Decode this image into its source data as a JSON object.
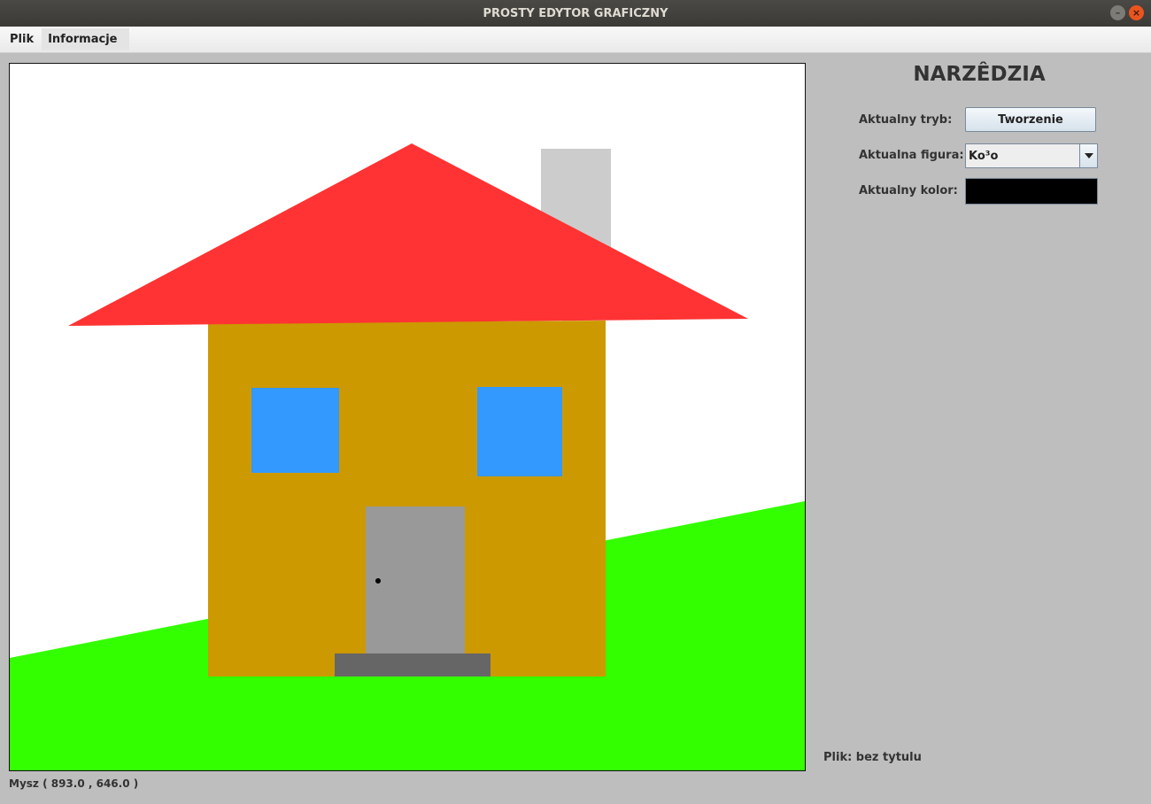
{
  "window": {
    "title": "PROSTY EDYTOR GRAFICZNY",
    "minimize_glyph": "–",
    "close_glyph": "×"
  },
  "menu": {
    "file_label": "Plik",
    "info_label": "Informacje"
  },
  "canvas": {
    "background": "#ffffff",
    "colors": {
      "grass": "#33ff00",
      "roof": "#ff3333",
      "chimney": "#cccccc",
      "wall": "#cc9900",
      "window": "#3399ff",
      "door": "#999999",
      "step": "#666666",
      "door_knob": "#000000"
    }
  },
  "status": {
    "mouse": "Mysz ( 893.0 , 646.0 )",
    "file": "Plik: bez tytulu"
  },
  "tools": {
    "title": "NARZÊDZIA",
    "mode_label": "Aktualny tryb:",
    "mode_value": "Tworzenie",
    "shape_label": "Aktualna figura:",
    "shape_value": "Ko³o",
    "color_label": "Aktualny kolor:",
    "current_color": "#000000"
  }
}
